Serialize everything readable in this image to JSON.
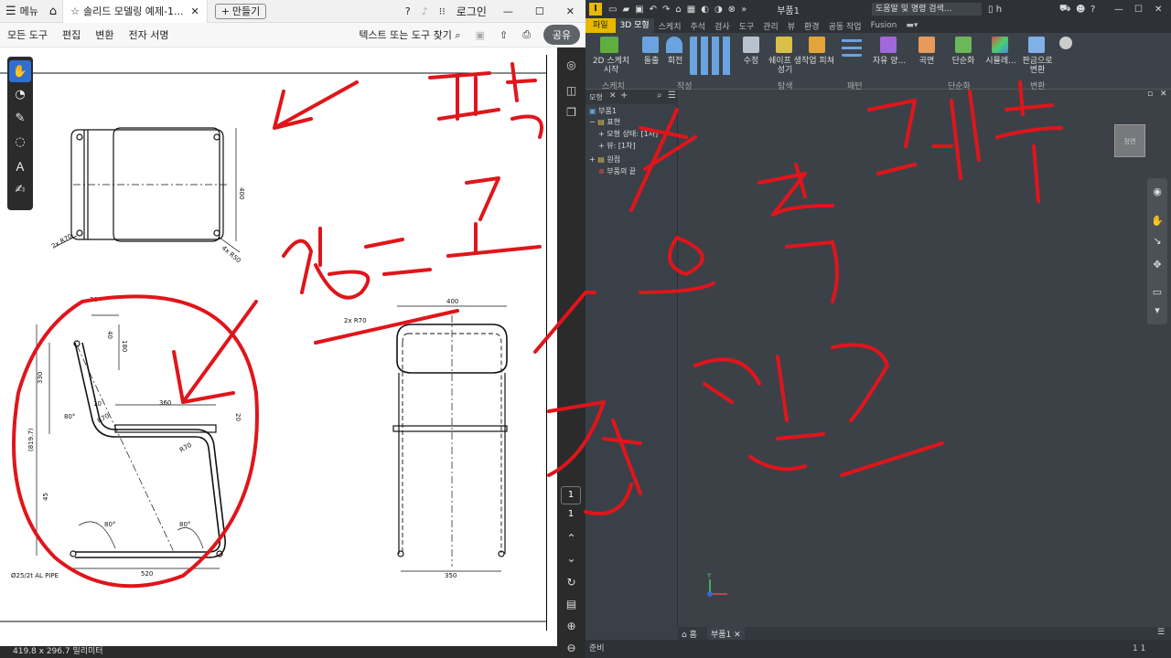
{
  "pdf": {
    "menu_label": "메뉴",
    "tab_title": "솔리드 모델링 예제-1...",
    "create_label": "만들기",
    "login_label": "로그인",
    "menus": [
      "모든 도구",
      "편집",
      "변환",
      "전자 서명"
    ],
    "find_label": "텍스트 또는 도구 찾기",
    "share_label": "공유",
    "page_current": "1",
    "page_total": "1",
    "dimensions": "419.8 x 296.7 밀리미터",
    "left_tools": [
      "hand-tool-icon",
      "comment-icon",
      "pen-icon",
      "lasso-icon",
      "text-select-icon",
      "sign-icon"
    ],
    "right_tools": [
      "ai-assistant-icon",
      "bookmark-icon",
      "copy-icon"
    ],
    "drawing_texts": {
      "d400": "400",
      "r70a": "2x R70",
      "r50": "4x R50",
      "d20a": "20",
      "d40": "40",
      "d180": "180",
      "d330": "330",
      "d10": "10",
      "d360": "360",
      "d20b": "20",
      "r70b": "R70",
      "r70c": "R70",
      "d80a": "80°",
      "d8197": "(819.7)",
      "d45": "45",
      "d80b": "80°",
      "d80c": "80°",
      "pipe": "Ø25/2t AL PIPE",
      "d520": "520",
      "d400b": "400",
      "r70d": "2x R70",
      "d350": "350"
    }
  },
  "inventor": {
    "part_title": "부품1",
    "search_placeholder": "도움말 및 명령 검색...",
    "user_initial": "h",
    "tabs": [
      "파일",
      "3D 모형",
      "스케치",
      "주석",
      "검사",
      "도구",
      "관리",
      "뷰",
      "환경",
      "공동 작업",
      "Fusion"
    ],
    "ribbon_buttons": [
      "2D 스케치 시작",
      "돌출",
      "회전",
      "수정",
      "쉐이프 생성기",
      "작업 피쳐",
      "자유 양...",
      "곡면",
      "단순화",
      "시뮬레...",
      "판금으로 변환"
    ],
    "ribbon_groups": [
      "스케치",
      "작성",
      "탐색",
      "패턴",
      "단순화",
      "변환"
    ],
    "browser_head": "모형",
    "tree": [
      "부품1",
      "표현",
      "모형 상태: [1차]",
      "뷰: [1차]",
      "원점",
      "부품의 끝"
    ],
    "home_tab": "홈",
    "doc_tab": "부품1",
    "status": "준비",
    "status_pages": "1    1",
    "viewcube_label": "정면"
  },
  "accent": {
    "red_ink": "#e0151b",
    "inventor_yellow": "#e8b900",
    "pdf_share": "#5f6368"
  }
}
